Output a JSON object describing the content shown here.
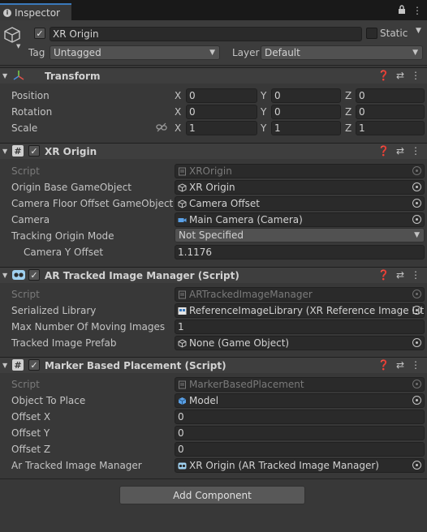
{
  "tab": {
    "title": "Inspector",
    "icons": [
      "lock-icon",
      "menu-icon"
    ]
  },
  "header": {
    "enabled": true,
    "name": "XR Origin",
    "static_label": "Static",
    "tag_label": "Tag",
    "tag_value": "Untagged",
    "layer_label": "Layer",
    "layer_value": "Default"
  },
  "transform": {
    "title": "Transform",
    "rows": [
      {
        "label": "Position",
        "x": "0",
        "y": "0",
        "z": "0"
      },
      {
        "label": "Rotation",
        "x": "0",
        "y": "0",
        "z": "0"
      },
      {
        "label": "Scale",
        "x": "1",
        "y": "1",
        "z": "1"
      }
    ],
    "axis_labels": [
      "X",
      "Y",
      "Z"
    ]
  },
  "xr_origin": {
    "title": "XR Origin",
    "enabled": true,
    "rows": [
      {
        "label": "Script",
        "value": "XROrigin"
      },
      {
        "label": "Origin Base GameObject",
        "value": "XR Origin"
      },
      {
        "label": "Camera Floor Offset GameObject",
        "value": "Camera Offset"
      },
      {
        "label": "Camera",
        "value": "Main Camera (Camera)"
      },
      {
        "label": "Tracking Origin Mode",
        "value": "Not Specified"
      },
      {
        "label": "Camera Y Offset",
        "value": "1.1176"
      }
    ]
  },
  "ar_manager": {
    "title": "AR Tracked Image Manager (Script)",
    "enabled": true,
    "rows": [
      {
        "label": "Script",
        "value": "ARTrackedImageManager"
      },
      {
        "label": "Serialized Library",
        "value": "ReferenceImageLibrary (XR Reference Image Lit"
      },
      {
        "label": "Max Number Of Moving Images",
        "value": "1"
      },
      {
        "label": "Tracked Image Prefab",
        "value": "None (Game Object)"
      }
    ]
  },
  "marker": {
    "title": "Marker Based Placement (Script)",
    "enabled": true,
    "rows": [
      {
        "label": "Script",
        "value": "MarkerBasedPlacement"
      },
      {
        "label": "Object To Place",
        "value": "Model"
      },
      {
        "label": "Offset X",
        "value": "0"
      },
      {
        "label": "Offset Y",
        "value": "0"
      },
      {
        "label": "Offset Z",
        "value": "0"
      },
      {
        "label": "Ar Tracked Image Manager",
        "value": "XR Origin (AR Tracked Image Manager)"
      }
    ]
  },
  "add_component_label": "Add Component",
  "colors": {
    "accent": "#3a79bb",
    "panel": "#383838",
    "field": "#2a2a2a",
    "tabbar": "#191919"
  }
}
